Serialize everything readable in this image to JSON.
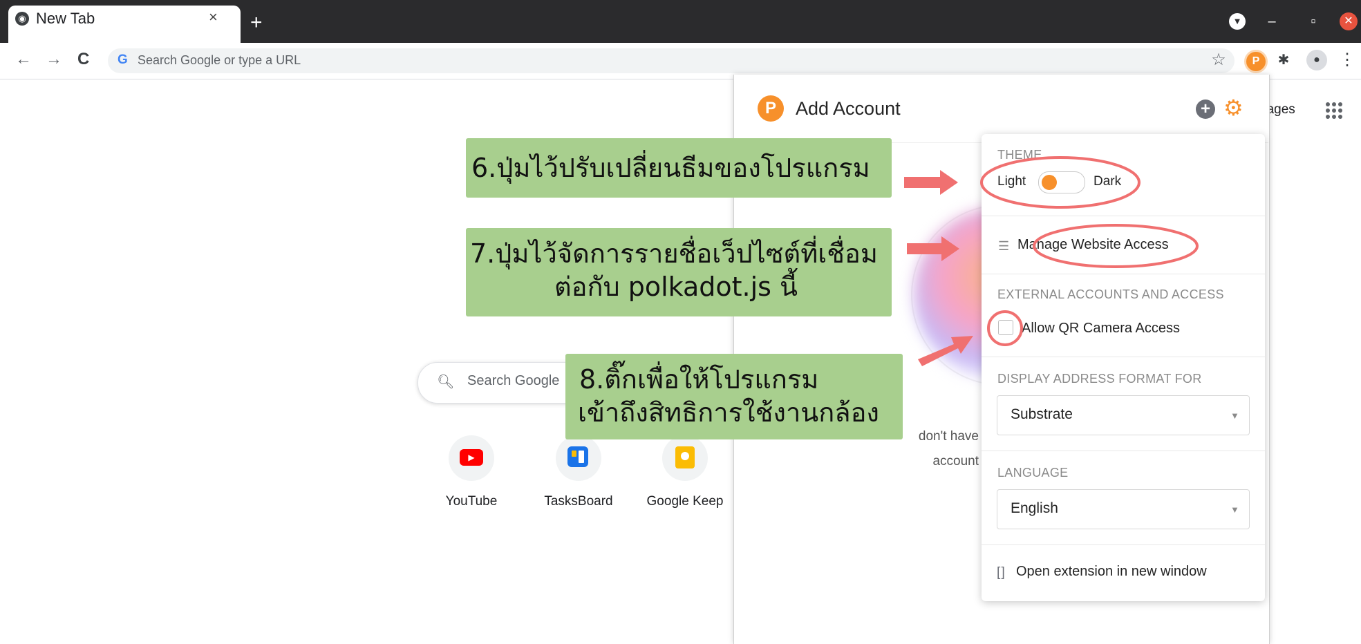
{
  "browser": {
    "tab_title": "New Tab",
    "tab_close": "×",
    "new_tab": "+",
    "omnibox_placeholder": "Search Google or type a URL",
    "g_logo": "G",
    "back_icon": "←",
    "forward_icon": "→",
    "reload_icon": "C",
    "star_icon": "☆",
    "menu_icon": "⋮"
  },
  "ntp": {
    "search_placeholder": "Search Google",
    "apps_text": "nages",
    "shortcuts": [
      {
        "label": "YouTube",
        "color": "#ff0000"
      },
      {
        "label": "TasksBoard",
        "color": "#1a73e8"
      },
      {
        "label": "Google Keep",
        "color": "#fbbc04"
      }
    ]
  },
  "extension": {
    "title": "Add Account",
    "no_account_line1": "don't have",
    "no_account_line2": "account",
    "menu": {
      "theme_heading": "THEME",
      "theme_light": "Light",
      "theme_dark": "Dark",
      "theme_value": "Light",
      "manage_access": "Manage Website Access",
      "external_heading": "EXTERNAL ACCOUNTS AND ACCESS",
      "allow_qr": "Allow QR Camera Access",
      "allow_qr_checked": false,
      "address_heading": "DISPLAY ADDRESS FORMAT FOR",
      "address_value": "Substrate",
      "language_heading": "LANGUAGE",
      "language_value": "English",
      "open_window": "Open extension in new window"
    }
  },
  "annotations": {
    "note6": "6.ปุ่มไว้ปรับเปลี่ยนธีมของโปรแกรม",
    "note7_line1": "7.ปุ่มไว้จัดการรายชื่อเว็ปไซต์ที่เชื่อม",
    "note7_line2": "ต่อกับ polkadot.js นี้",
    "note8_line1": "8.ติ๊กเพื่อให้โปรแกรม",
    "note8_line2": "เข้าถึงสิทธิการใช้งานกล้อง"
  },
  "colors": {
    "accent": "#f7902b",
    "annotation_fill": "#a8cf8e",
    "annotation_ring": "#f07070"
  }
}
